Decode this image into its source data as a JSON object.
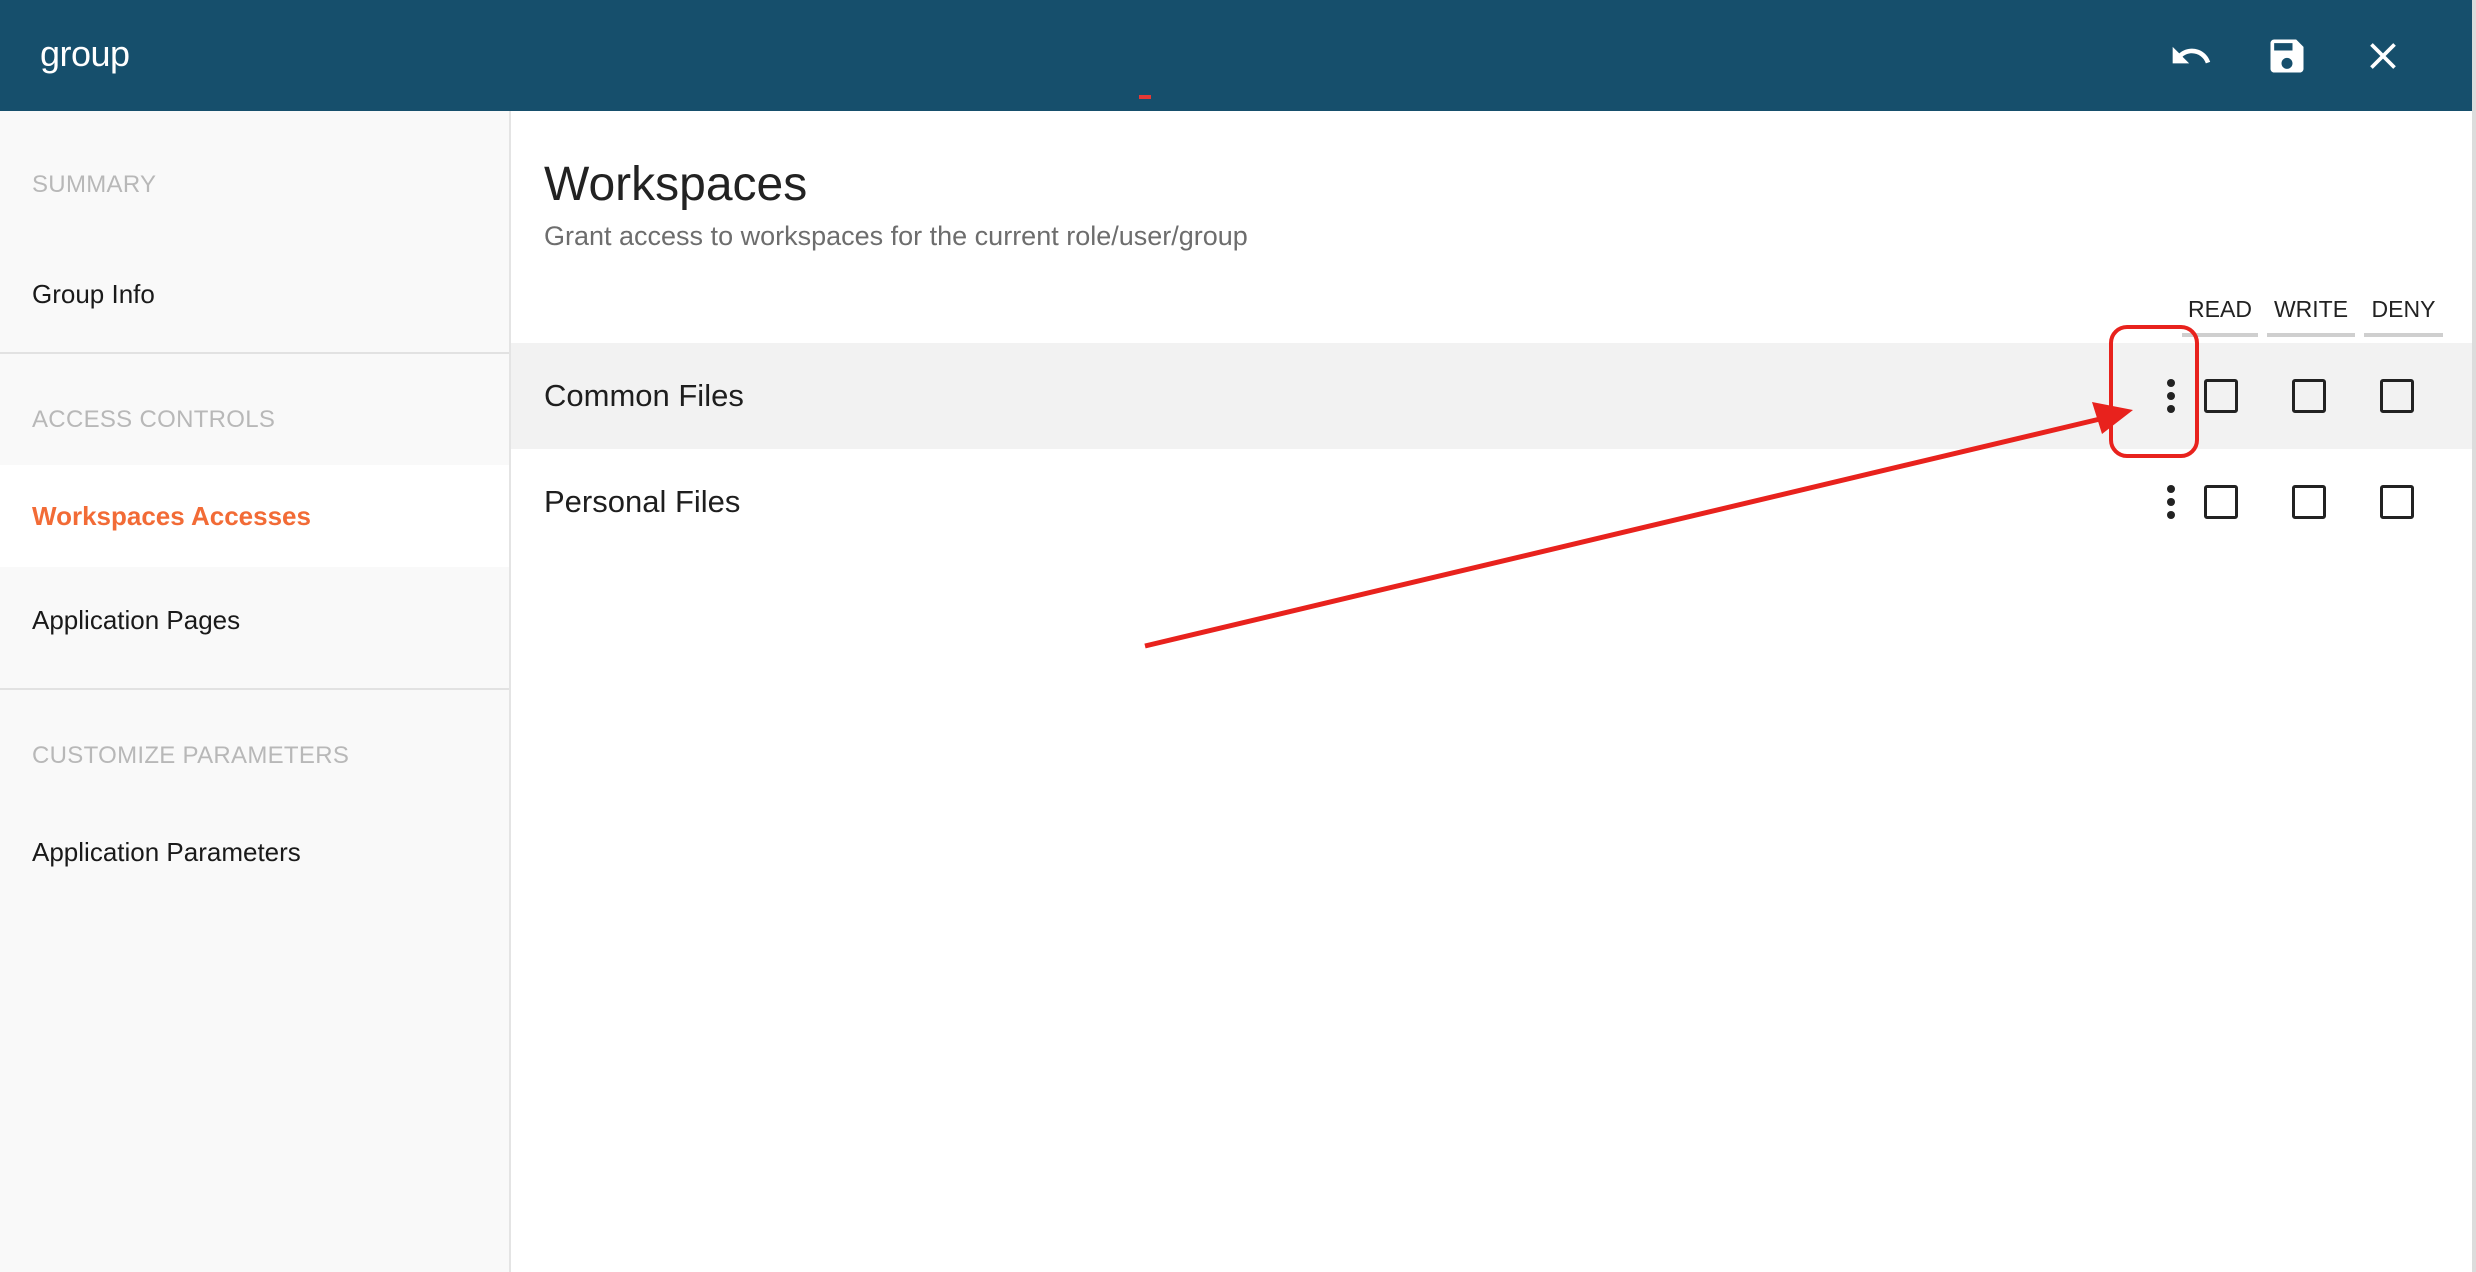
{
  "header": {
    "title": "group",
    "icons": {
      "undo": "undo-icon",
      "save": "save-icon",
      "close": "close-icon"
    }
  },
  "sidebar": {
    "sections": [
      {
        "label": "SUMMARY",
        "items": [
          {
            "label": "Group Info",
            "active": false
          }
        ]
      },
      {
        "label": "ACCESS CONTROLS",
        "items": [
          {
            "label": "Workspaces Accesses",
            "active": true
          },
          {
            "label": "Application Pages",
            "active": false
          }
        ]
      },
      {
        "label": "CUSTOMIZE PARAMETERS",
        "items": [
          {
            "label": "Application Parameters",
            "active": false
          }
        ]
      }
    ]
  },
  "main": {
    "title": "Workspaces",
    "subtitle": "Grant access to workspaces for the current role/user/group",
    "columns": [
      "READ",
      "WRITE",
      "DENY"
    ],
    "rows": [
      {
        "label": "Common Files",
        "highlighted": true,
        "read": false,
        "write": false,
        "deny": false
      },
      {
        "label": "Personal Files",
        "highlighted": false,
        "read": false,
        "write": false,
        "deny": false
      }
    ]
  },
  "colors": {
    "header_bg": "#164f6c",
    "accent": "#f26b36",
    "annotation": "#e8221d"
  }
}
